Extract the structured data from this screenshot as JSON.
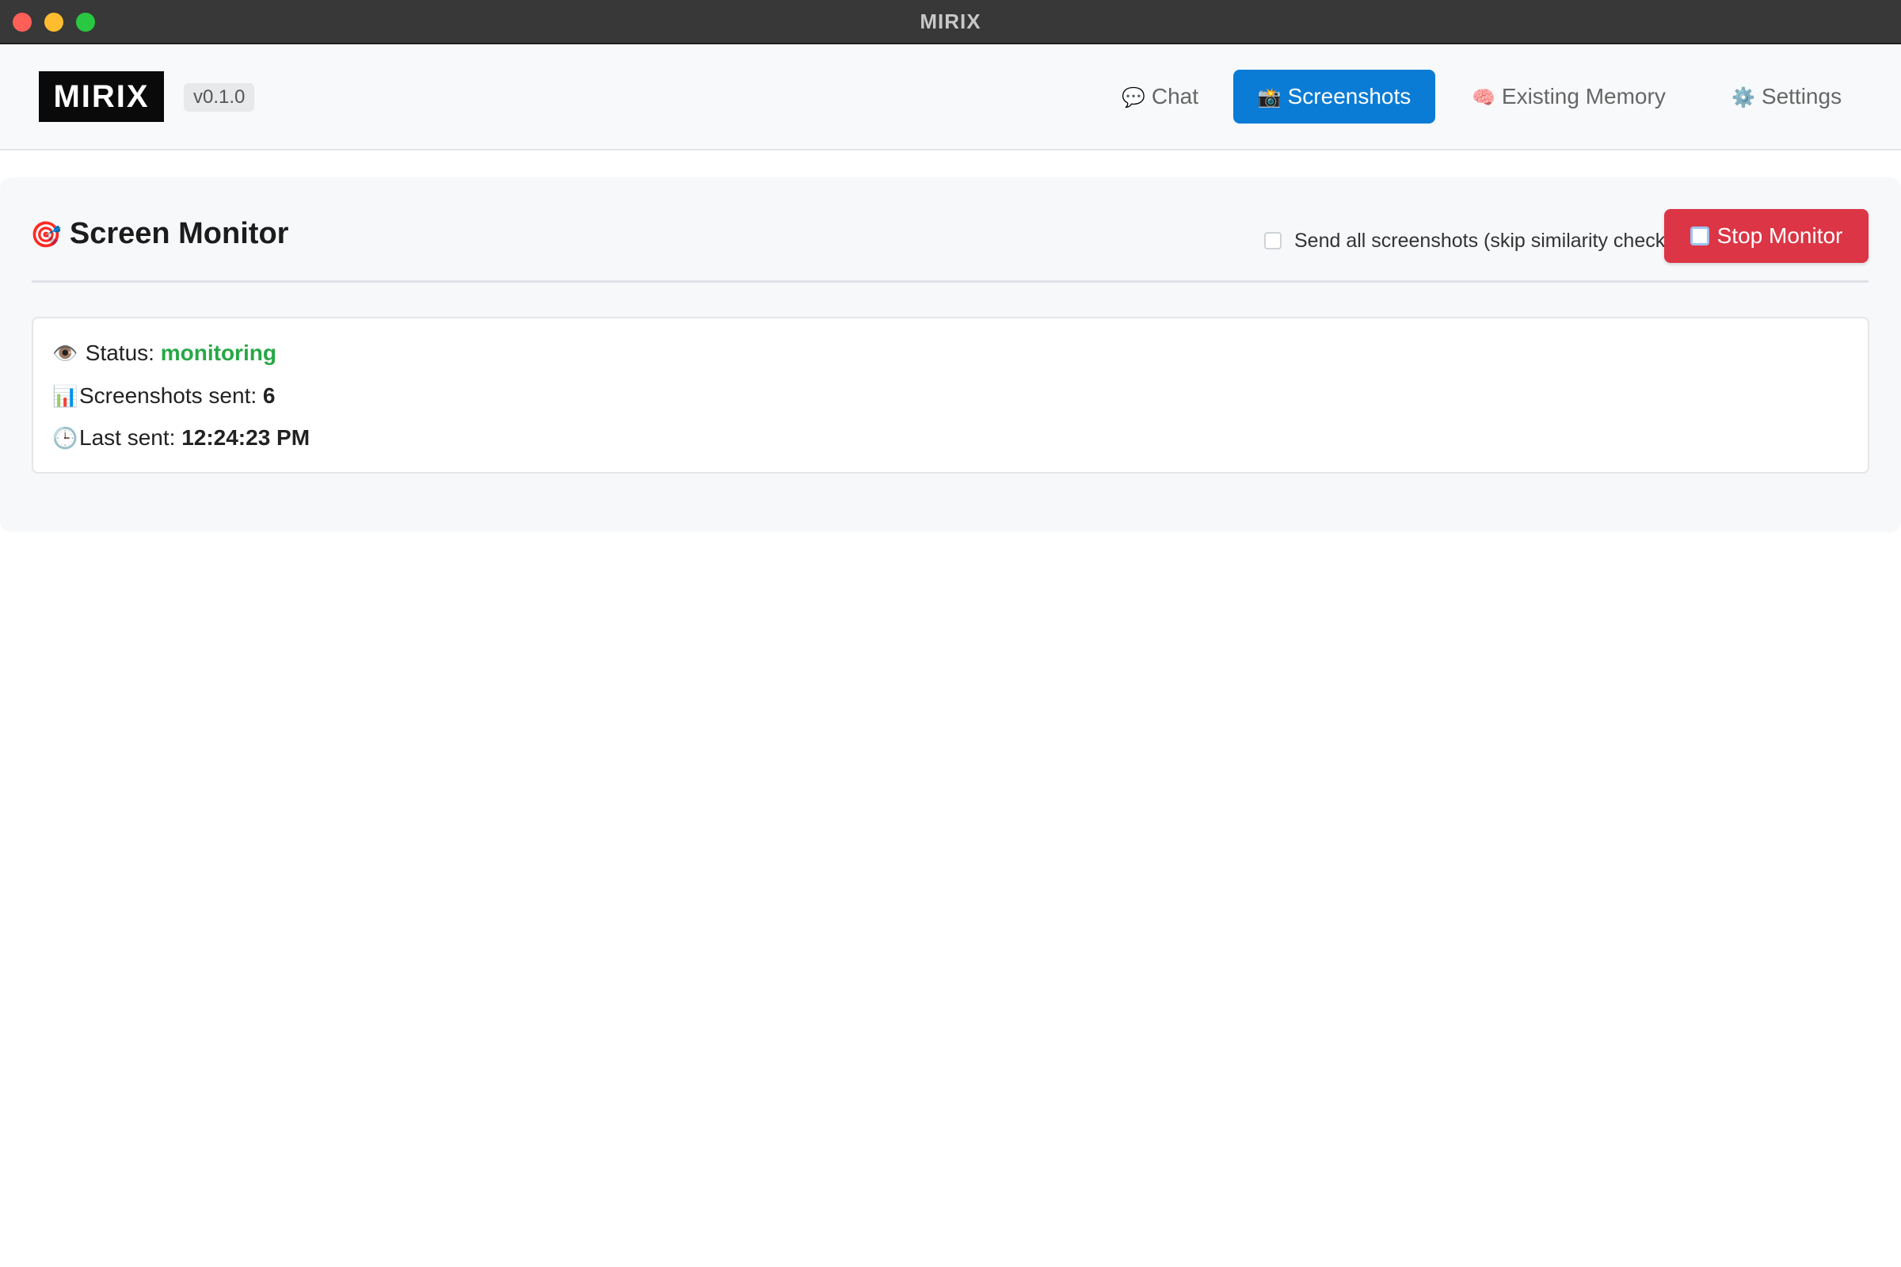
{
  "window": {
    "title": "MIRIX"
  },
  "header": {
    "logo_text": "MIRIX",
    "version": "v0.1.0",
    "tabs": [
      {
        "icon": "speech-bubble-icon",
        "glyph": "💬",
        "label": "Chat",
        "active": false
      },
      {
        "icon": "camera-icon",
        "glyph": "📸",
        "label": "Screenshots",
        "active": true
      },
      {
        "icon": "brain-icon",
        "glyph": "🧠",
        "label": "Existing Memory",
        "active": false
      },
      {
        "icon": "gear-icon",
        "glyph": "⚙️",
        "label": "Settings",
        "active": false
      }
    ]
  },
  "monitor": {
    "title_glyph": "🎯",
    "title": "Screen Monitor",
    "skip_checkbox": {
      "label": "Send all screenshots (skip similarity check)",
      "checked": false
    },
    "stop_button": {
      "label": "Stop Monitor"
    },
    "status": {
      "eye_glyph": "👁️",
      "status_label": "Status:",
      "status_value": "monitoring",
      "chart_glyph": "📊",
      "sent_label": "Screenshots sent:",
      "sent_value": "6",
      "clock_glyph": "🕒",
      "last_label": "Last sent:",
      "last_value": "12:24:23 PM"
    }
  },
  "colors": {
    "accent": "#0a7cd6",
    "danger": "#dc3545",
    "success": "#28a745"
  }
}
